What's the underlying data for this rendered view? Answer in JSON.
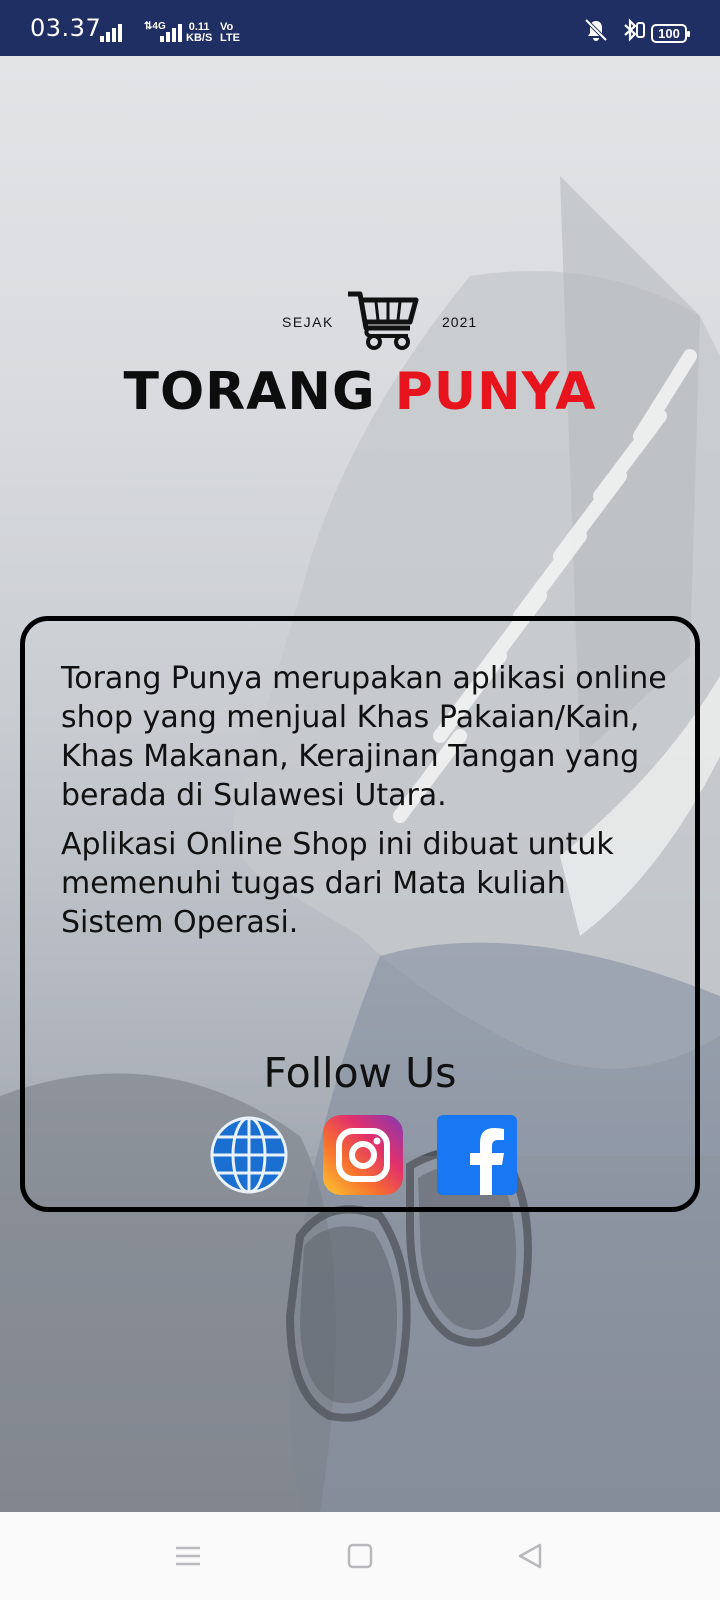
{
  "status_bar": {
    "time": "03.37",
    "network": "4G",
    "speed_value": "0.11",
    "speed_unit": "KB/S",
    "volte_top": "Vo",
    "volte_bottom": "LTE",
    "battery": "100"
  },
  "logo": {
    "since_label": "SEJAK",
    "year": "2021",
    "title_part1": "TORANG",
    "title_part2": "PUNYA",
    "icon": "shopping-cart-icon"
  },
  "about": {
    "paragraph1": "Torang Punya merupakan aplikasi online shop yang menjual Khas Pakaian/Kain, Khas Makanan, Kerajinan Tangan yang berada di Sulawesi Utara.",
    "paragraph2": "Aplikasi Online Shop ini dibuat untuk memenuhi tugas dari Mata kuliah Sistem Operasi."
  },
  "follow": {
    "heading": "Follow Us",
    "links": [
      {
        "icon": "globe-icon"
      },
      {
        "icon": "instagram-icon"
      },
      {
        "icon": "facebook-icon"
      }
    ]
  },
  "nav_bar": {
    "buttons": [
      {
        "icon": "menu-icon"
      },
      {
        "icon": "home-square-icon"
      },
      {
        "icon": "back-triangle-icon"
      }
    ]
  },
  "colors": {
    "status_bar_bg": "#1f2e63",
    "brand_red": "#e8141d",
    "brand_black": "#0d0d0d",
    "facebook_blue": "#1877f2",
    "globe_blue": "#1a6fd1"
  }
}
